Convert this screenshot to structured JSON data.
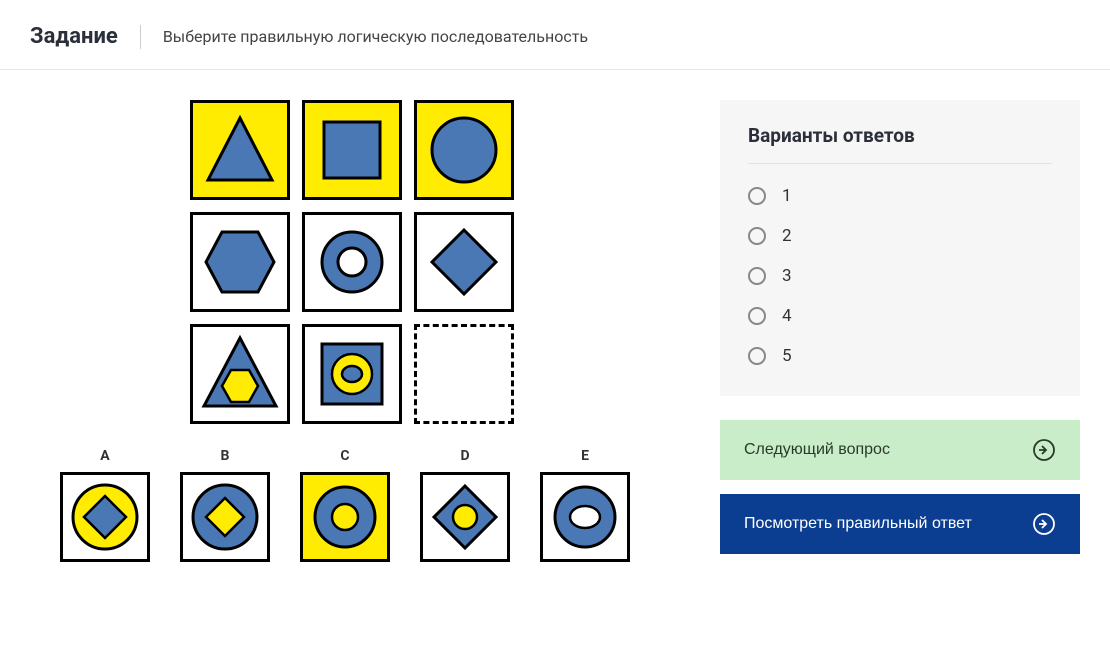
{
  "header": {
    "title": "Задание",
    "instruction": "Выберите правильную логическую последовательность"
  },
  "grid": {
    "cells": [
      {
        "bg": "yellow",
        "shape": "triangle",
        "fill": "#4a78b5",
        "stroke": "#000"
      },
      {
        "bg": "yellow",
        "shape": "square",
        "fill": "#4a78b5",
        "stroke": "#000"
      },
      {
        "bg": "yellow",
        "shape": "circle",
        "fill": "#4a78b5",
        "stroke": "#000"
      },
      {
        "bg": "white",
        "shape": "hexagon",
        "fill": "#4a78b5",
        "stroke": "#000"
      },
      {
        "bg": "white",
        "shape": "ring",
        "fill": "#4a78b5",
        "stroke": "#000"
      },
      {
        "bg": "white",
        "shape": "diamond",
        "fill": "#4a78b5",
        "stroke": "#000"
      },
      {
        "bg": "white",
        "shape": "triangle-with-hexagon",
        "fill": "#4a78b5",
        "inner": "#ffec00",
        "stroke": "#000"
      },
      {
        "bg": "white",
        "shape": "square-with-ring",
        "fill": "#4a78b5",
        "inner": "#ffec00",
        "stroke": "#000"
      },
      {
        "bg": "white",
        "shape": "empty",
        "dashed": true
      }
    ]
  },
  "answers": [
    {
      "label": "A",
      "bg": "white",
      "shape": "circle-with-diamond",
      "fill": "#ffec00",
      "inner": "#4a78b5"
    },
    {
      "label": "B",
      "bg": "white",
      "shape": "ring-with-diamond",
      "fill": "#4a78b5",
      "inner": "#ffec00"
    },
    {
      "label": "C",
      "bg": "yellow",
      "shape": "ring",
      "fill": "#4a78b5",
      "innerHole": "#ffec00"
    },
    {
      "label": "D",
      "bg": "white",
      "shape": "diamond-with-circle",
      "fill": "#4a78b5",
      "inner": "#ffec00"
    },
    {
      "label": "E",
      "bg": "white",
      "shape": "ring-oval",
      "fill": "#4a78b5"
    }
  ],
  "options": {
    "title": "Варианты ответов",
    "items": [
      "1",
      "2",
      "3",
      "4",
      "5"
    ]
  },
  "buttons": {
    "next": "Следующий вопрос",
    "show": "Посмотреть правильный ответ"
  },
  "colors": {
    "blue": "#4a78b5",
    "yellow": "#ffec00",
    "darkblue": "#0b3e91",
    "green": "#c8edc8"
  }
}
